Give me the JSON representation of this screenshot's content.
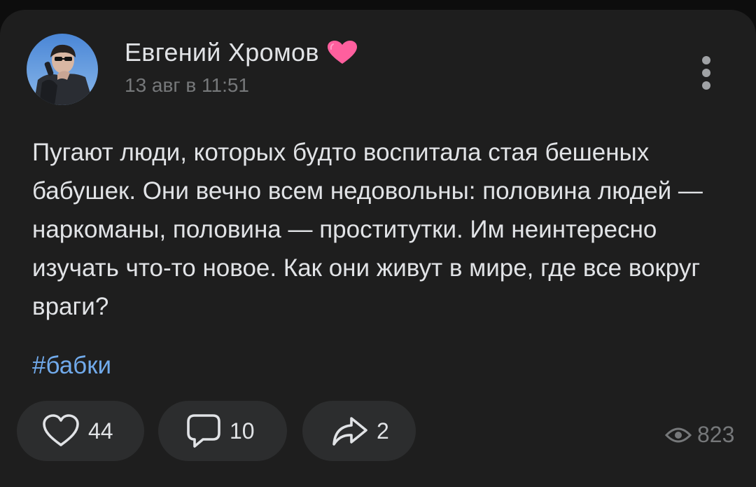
{
  "post": {
    "author_name": "Евгений Хромов",
    "date": "13 авг в 11:51",
    "text": "Пугают люди, которых будто воспитала стая бешеных бабушек. Они вечно всем недовольны: половина людей — наркоманы, половина — проститутки. Им неинтересно изучать что-то новое. Как они живут в мире, где все вокруг враги?",
    "hashtag": "#бабки"
  },
  "actions": {
    "likes": "44",
    "comments": "10",
    "shares": "2",
    "views": "823"
  },
  "icons": {
    "badge": "heart-badge-icon",
    "more": "vertical-dots-icon",
    "like": "heart-outline-icon",
    "comment": "comment-bubble-icon",
    "share": "share-arrow-icon",
    "views": "eye-icon"
  },
  "colors": {
    "background": "#0d0d0d",
    "card": "#1e1e1e",
    "button": "#2c2d2e",
    "text_primary": "#e1e3e6",
    "text_secondary": "#76787a",
    "link": "#71aaeb",
    "heart_badge": "#ff5f9e"
  }
}
